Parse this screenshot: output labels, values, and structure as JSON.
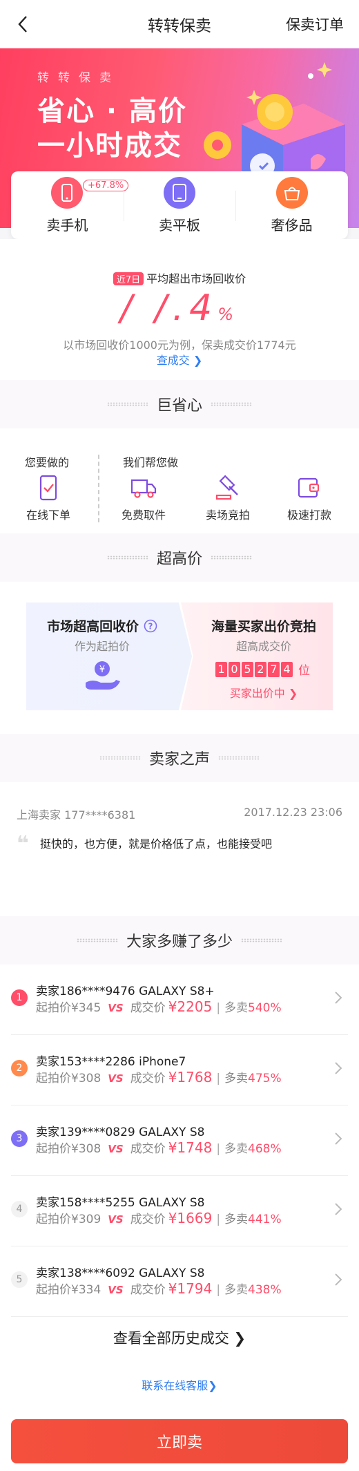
{
  "nav": {
    "title": "转转保卖",
    "orders_label": "保卖订单"
  },
  "banner": {
    "small": "转转保卖",
    "line1": "省心 · 高价",
    "line2": "一小时成交"
  },
  "categories": [
    {
      "label": "卖手机",
      "badge": "+67.8%",
      "color": "#ff5a6e"
    },
    {
      "label": "卖平板",
      "badge": "",
      "color": "#7d6ef5"
    },
    {
      "label": "奢侈品",
      "badge": "",
      "color": "#ff7a3c"
    }
  ],
  "stat": {
    "tag": "近7日",
    "headline": "平均超出市场回收价",
    "number": "/ /.4",
    "unit": "%",
    "desc": "以市场回收价1000元为例，保卖成交价1774元",
    "link": "查成交 ❯"
  },
  "sections": {
    "save": "巨省心",
    "price": "超高价",
    "voice": "卖家之声",
    "earn": "大家多赚了多少"
  },
  "save": {
    "you_label": "您要做的",
    "we_label": "我们帮您做",
    "items": [
      {
        "label": "在线下单",
        "icon": "phone-check-icon"
      },
      {
        "label": "免费取件",
        "icon": "truck-icon"
      },
      {
        "label": "卖场竞拍",
        "icon": "gavel-icon"
      },
      {
        "label": "极速打款",
        "icon": "wallet-icon"
      }
    ]
  },
  "price": {
    "left_title": "市场超高回收价",
    "left_sub": "作为起拍价",
    "right_title": "海量买家出价竞拍",
    "right_sub": "超高成交价",
    "digits": [
      "1",
      "0",
      "5",
      "2",
      "7",
      "4"
    ],
    "digits_unit": "位",
    "right_link": "买家出价中 ❯"
  },
  "voice": {
    "name": "上海卖家 177****6381",
    "time": "2017.12.23 23:06",
    "text": "挺快的，也方便，就是价格低了点，也能接受吧"
  },
  "earn": {
    "rows": [
      {
        "rank": "1",
        "line1": "卖家186****9476 GALAXY S8+",
        "start_label": "起拍价¥345",
        "vs": "VS",
        "deal_label": "成交价",
        "deal": "¥2205",
        "more_label": "多卖",
        "pct": "540%",
        "color": "#ff4d6a"
      },
      {
        "rank": "2",
        "line1": "卖家153****2286 iPhone7",
        "start_label": "起拍价¥308",
        "vs": "VS",
        "deal_label": "成交价",
        "deal": "¥1768",
        "more_label": "多卖",
        "pct": "475%",
        "color": "#ff8a4c"
      },
      {
        "rank": "3",
        "line1": "卖家139****0829 GALAXY S8",
        "start_label": "起拍价¥308",
        "vs": "VS",
        "deal_label": "成交价",
        "deal": "¥1748",
        "more_label": "多卖",
        "pct": "468%",
        "color": "#7d6ef5"
      },
      {
        "rank": "4",
        "line1": "卖家158****5255 GALAXY S8",
        "start_label": "起拍价¥309",
        "vs": "VS",
        "deal_label": "成交价",
        "deal": "¥1669",
        "more_label": "多卖",
        "pct": "441%",
        "color": ""
      },
      {
        "rank": "5",
        "line1": "卖家138****6092 GALAXY S8",
        "start_label": "起拍价¥334",
        "vs": "VS",
        "deal_label": "成交价",
        "deal": "¥1794",
        "more_label": "多卖",
        "pct": "438%",
        "color": ""
      }
    ],
    "history_label": "查看全部历史成交 ❯",
    "service_label": "联系在线客服❯"
  },
  "bottom": {
    "button": "立即卖"
  },
  "colors": {
    "accent": "#ff4d6a",
    "link": "#2f7ef2",
    "button": "#f04c3b"
  }
}
